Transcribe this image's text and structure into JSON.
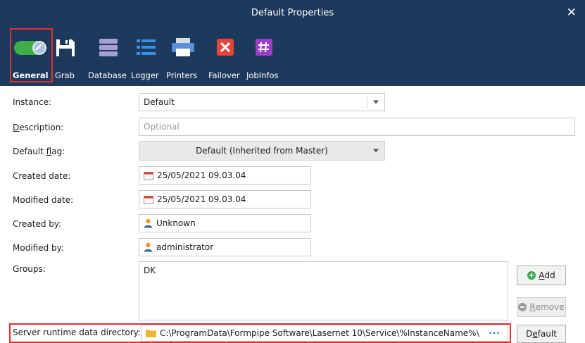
{
  "window": {
    "title": "Default Properties",
    "close_glyph": "✕"
  },
  "toolbar": {
    "items": [
      {
        "id": "general",
        "label": "General",
        "icon": "toggle-switch-icon",
        "selected": true
      },
      {
        "id": "grab",
        "label": "Grab",
        "icon": "floppy-disk-icon"
      },
      {
        "id": "database",
        "label": "Database",
        "icon": "database-icon"
      },
      {
        "id": "logger",
        "label": "Logger",
        "icon": "list-icon"
      },
      {
        "id": "printers",
        "label": "Printers",
        "icon": "printer-icon"
      },
      {
        "id": "failover",
        "label": "Failover",
        "icon": "failover-x-icon"
      },
      {
        "id": "jobinfos",
        "label": "JobInfos",
        "icon": "hashtag-icon"
      }
    ]
  },
  "form": {
    "instance": {
      "label": "Instance:",
      "value": "Default"
    },
    "description": {
      "label_pre": "",
      "label_key": "D",
      "label_post": "escription:",
      "placeholder": "Optional"
    },
    "default_flag": {
      "label_pre": "Default ",
      "label_key": "f",
      "label_post": "lag:",
      "value": "Default (Inherited from Master)"
    },
    "created_date": {
      "label": "Created date:",
      "value": "25/05/2021 09.03.04"
    },
    "modified_date": {
      "label": "Modified date:",
      "value": "25/05/2021 09.03.04"
    },
    "created_by": {
      "label": "Created by:",
      "value": "Unknown"
    },
    "modified_by": {
      "label": "Modified by:",
      "value": "administrator"
    },
    "groups": {
      "label": "Groups:",
      "value": "DK"
    },
    "server_dir": {
      "label": "Server runtime data directory:",
      "value": "C:\\ProgramData\\Formpipe Software\\Lasernet 10\\Service\\%InstanceName%\\",
      "browse": "···"
    }
  },
  "buttons": {
    "add": {
      "pre": "",
      "key": "A",
      "post": "dd"
    },
    "remove": {
      "pre": "",
      "key": "R",
      "post": "emove"
    },
    "default": {
      "pre": "D",
      "key": "e",
      "post": "fault"
    }
  },
  "colors": {
    "titlebar": "#1d3a5c",
    "highlight": "#e0302e",
    "accent_blue": "#1a6fc4"
  }
}
